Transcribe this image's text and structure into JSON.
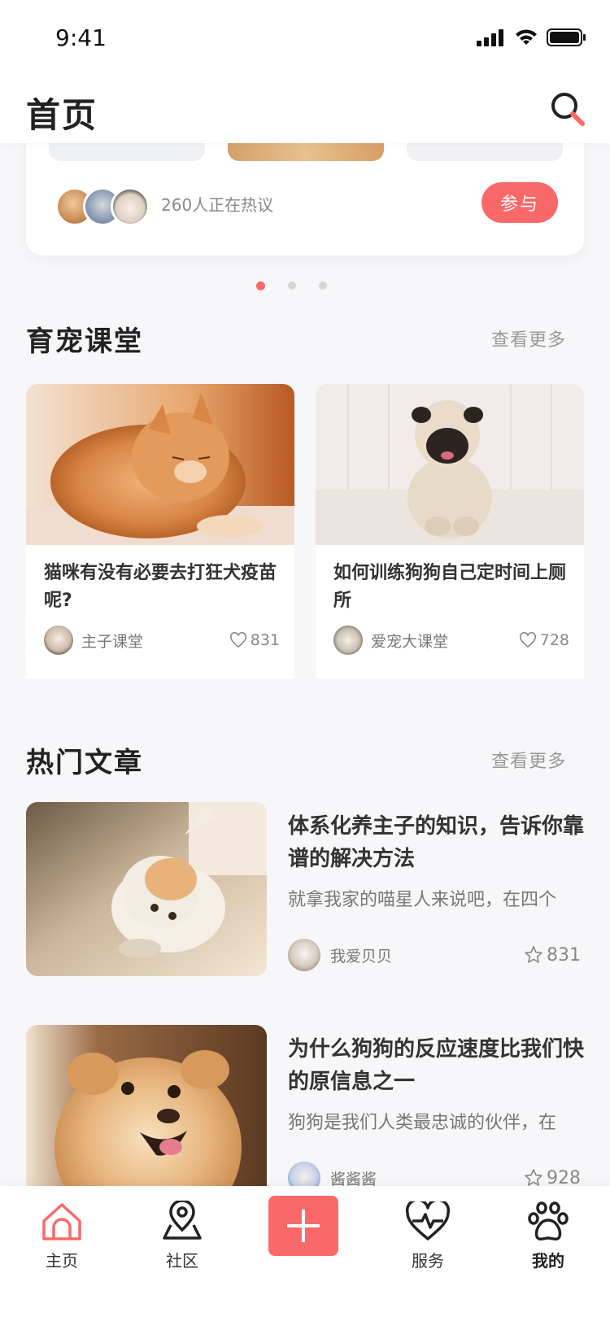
{
  "status": {
    "time": "9:41"
  },
  "header": {
    "title": "首页"
  },
  "topic": {
    "hot_text": "260人正在热议",
    "join_label": "参与"
  },
  "course": {
    "title": "育宠课堂",
    "more": "查看更多",
    "cards": [
      {
        "title": "猫咪有没有必要去打狂犬疫苗呢?",
        "author": "主子课堂",
        "likes": "831"
      },
      {
        "title": "如何训练狗狗自己定时间上厕所",
        "author": "爱宠大课堂",
        "likes": "728"
      }
    ]
  },
  "articles": {
    "title": "热门文章",
    "more": "查看更多",
    "items": [
      {
        "title": "体系化养主子的知识，告诉你靠谱的解决方法",
        "summary": "就拿我家的喵星人来说吧，在四个",
        "author": "我爱贝贝",
        "stars": "831"
      },
      {
        "title": "为什么狗狗的反应速度比我们快的原信息之一",
        "summary": "狗狗是我们人类最忠诚的伙伴，在",
        "author": "酱酱酱",
        "stars": "928"
      }
    ]
  },
  "tabbar": {
    "home": "主页",
    "community": "社区",
    "service": "服务",
    "me": "我的"
  },
  "colors": {
    "accent": "#fa6969",
    "text": "#333333",
    "muted": "#999999"
  }
}
